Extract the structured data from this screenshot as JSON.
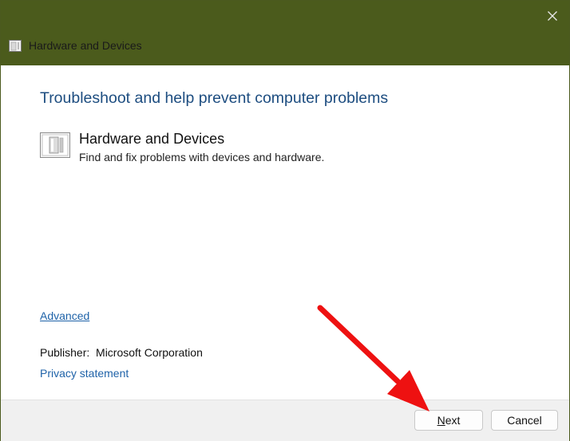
{
  "window": {
    "title": "Hardware and Devices",
    "titlebar_color": "#4b5b1c"
  },
  "close_icon": "close-icon",
  "main": {
    "heading": "Troubleshoot and help prevent computer problems",
    "troubleshooter": {
      "icon": "hardware-device-icon",
      "title": "Hardware and Devices",
      "description": "Find and fix problems with devices and hardware."
    },
    "advanced_link": "Advanced",
    "publisher": "Publisher:  Microsoft Corporation",
    "privacy_link": "Privacy statement"
  },
  "footer": {
    "next_mnemonic": "N",
    "next_rest": "ext",
    "cancel_label": "Cancel"
  },
  "annotation": {
    "type": "red-arrow",
    "color": "#ee1111",
    "points_to": "Next"
  }
}
